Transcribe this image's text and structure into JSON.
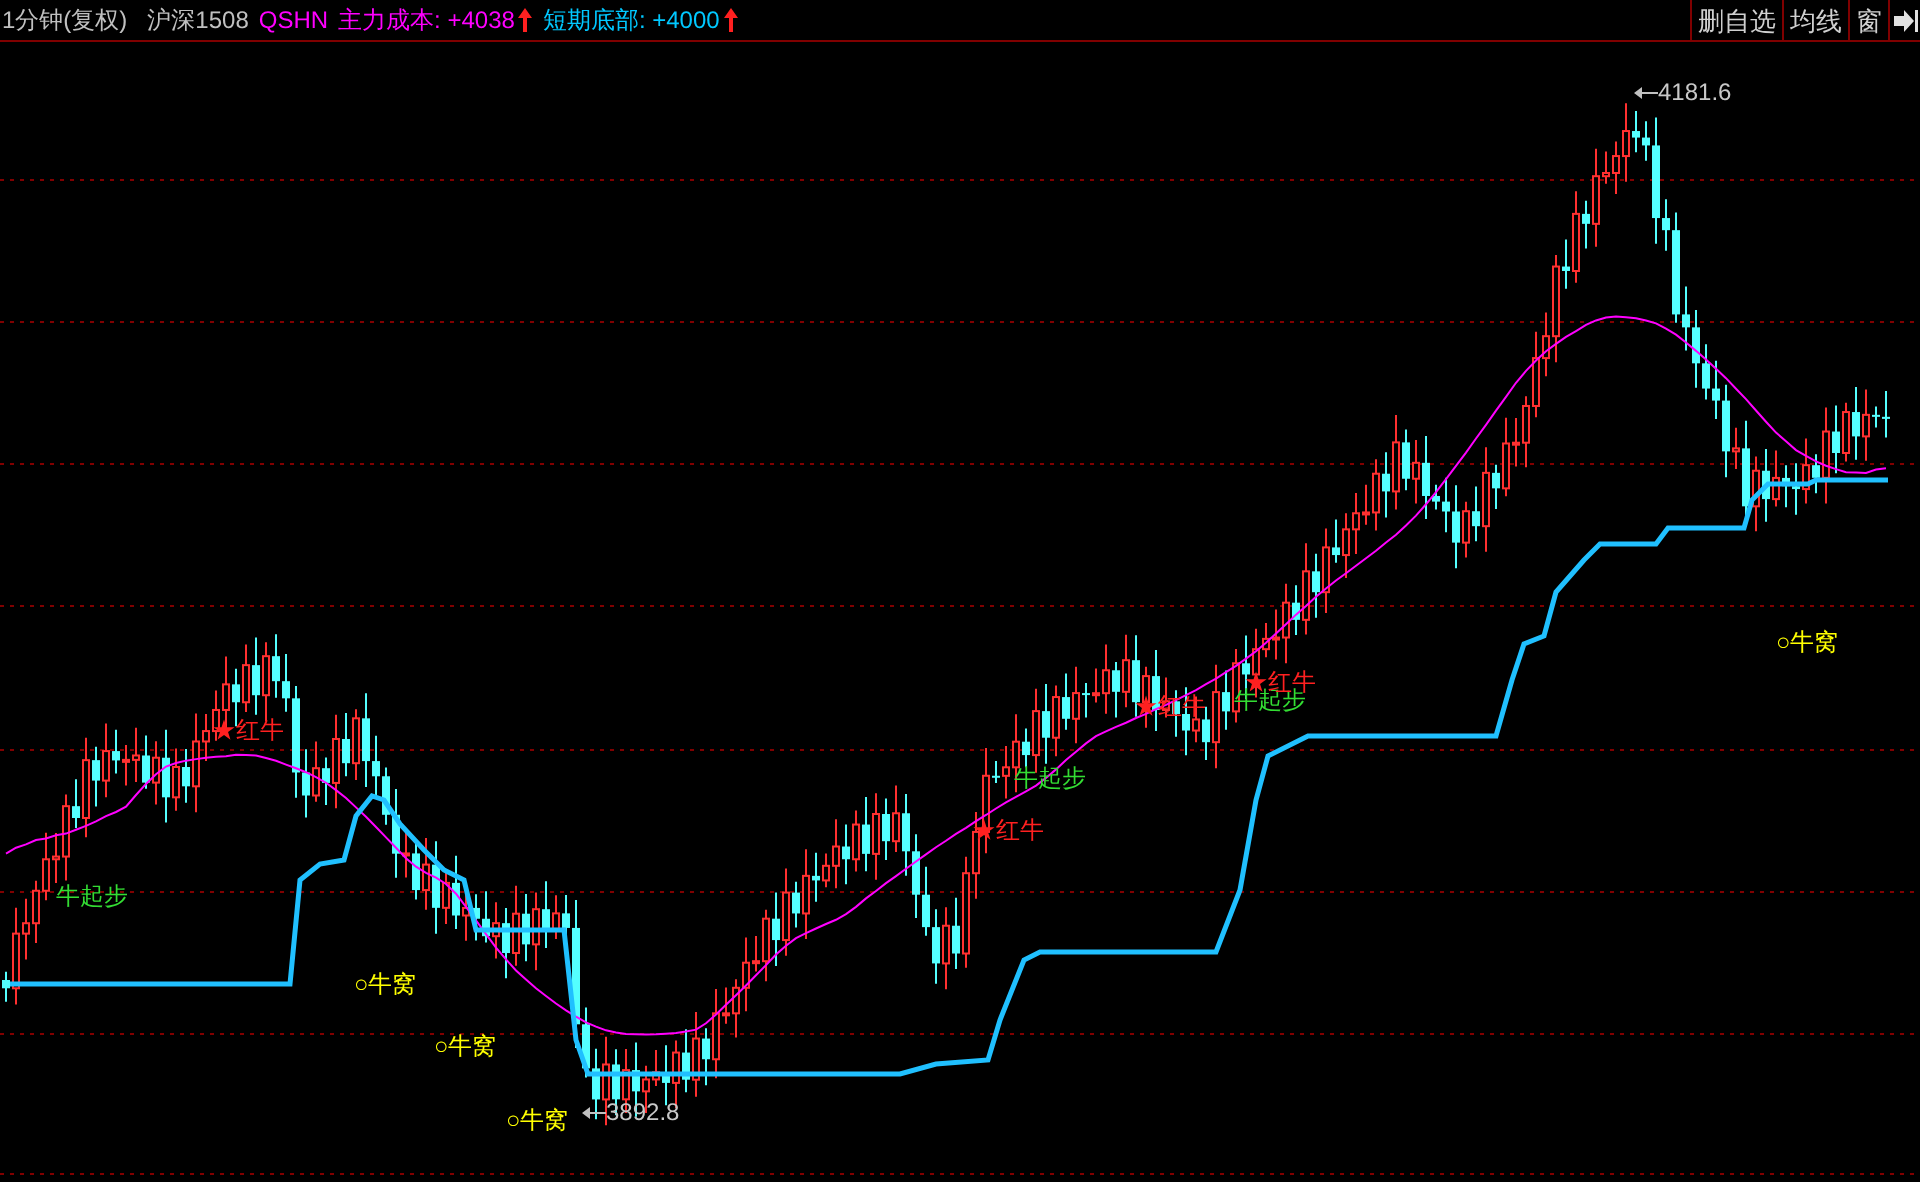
{
  "header": {
    "period": "1分钟(复权)",
    "symbol": "沪深1508",
    "indicator": "QSHN",
    "items": [
      {
        "label": "主力成本:",
        "value": "+4038",
        "color": "#ff00ff"
      },
      {
        "label": "短期底部:",
        "value": "+4000",
        "color": "#00c8ff"
      }
    ]
  },
  "toolbar": {
    "buttons": [
      "删自选",
      "均线",
      "窗"
    ]
  },
  "chart": {
    "signals": [
      {
        "kind": "start",
        "text": "牛起步"
      },
      {
        "kind": "red",
        "text": "★红牛"
      },
      {
        "kind": "den",
        "text": "○牛窝"
      },
      {
        "kind": "den",
        "text": "○牛窝"
      },
      {
        "kind": "den",
        "text": "○牛窝"
      },
      {
        "kind": "red",
        "text": "★红牛"
      },
      {
        "kind": "start",
        "text": "牛起步"
      },
      {
        "kind": "red",
        "text": "★红牛"
      },
      {
        "kind": "start",
        "text": "牛起步"
      },
      {
        "kind": "red",
        "text": "★红牛"
      },
      {
        "kind": "den",
        "text": "○牛窝"
      }
    ],
    "price_marks": [
      {
        "kind": "low",
        "text": "3892.8"
      },
      {
        "kind": "high",
        "text": "4181.6"
      }
    ]
  }
}
